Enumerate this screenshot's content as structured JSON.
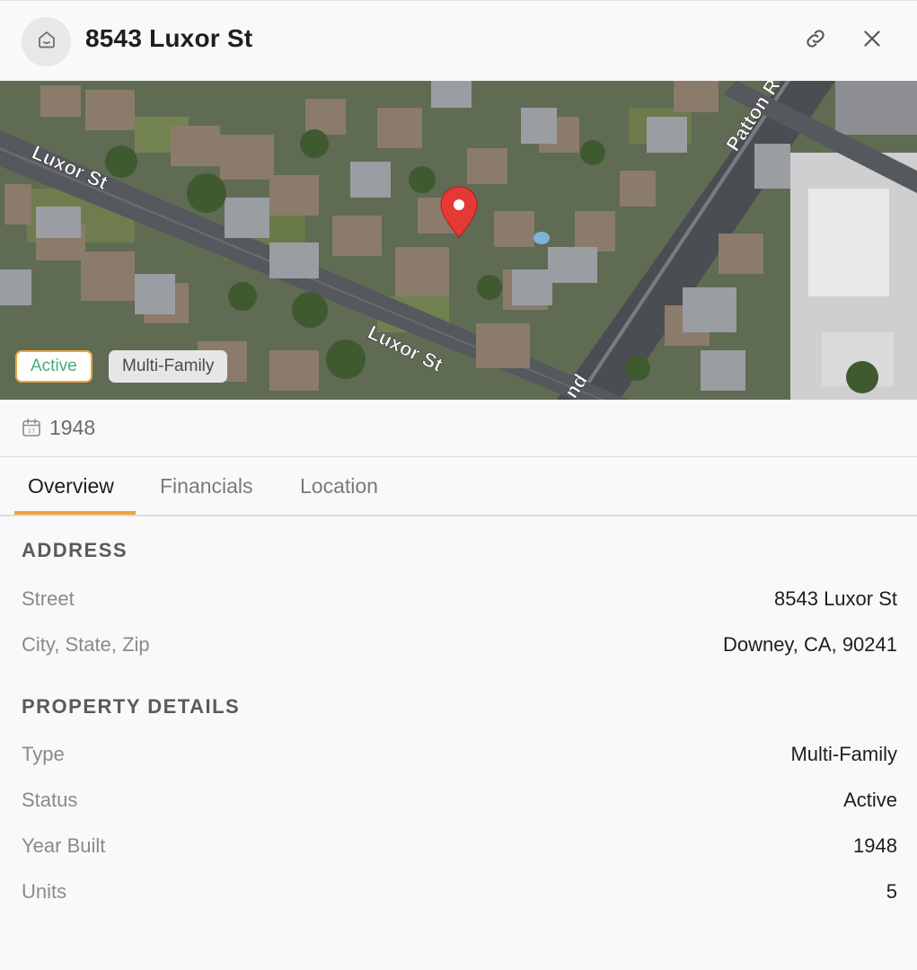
{
  "header": {
    "title": "8543 Luxor St",
    "avatar_icon": "home-icon",
    "link_icon": "link-icon",
    "close_icon": "close-icon"
  },
  "map": {
    "street_labels": [
      "Luxor St",
      "Luxor St",
      "Patton R",
      "nd"
    ],
    "marker_icon": "map-pin-icon"
  },
  "badges": {
    "status": "Active",
    "type": "Multi-Family"
  },
  "year_row": {
    "icon": "calendar-icon",
    "year": "1948"
  },
  "tabs": [
    {
      "label": "Overview",
      "active": true
    },
    {
      "label": "Financials",
      "active": false
    },
    {
      "label": "Location",
      "active": false
    }
  ],
  "address": {
    "title": "ADDRESS",
    "rows": [
      {
        "label": "Street",
        "value": "8543 Luxor St"
      },
      {
        "label": "City, State, Zip",
        "value": "Downey, CA, 90241"
      }
    ]
  },
  "details": {
    "title": "PROPERTY DETAILS",
    "rows": [
      {
        "label": "Type",
        "value": "Multi-Family"
      },
      {
        "label": "Status",
        "value": "Active"
      },
      {
        "label": "Year Built",
        "value": "1948"
      },
      {
        "label": "Units",
        "value": "5"
      }
    ]
  },
  "colors": {
    "accent": "#eda43c",
    "active_text": "#4aa97a",
    "pin": "#e53935"
  }
}
